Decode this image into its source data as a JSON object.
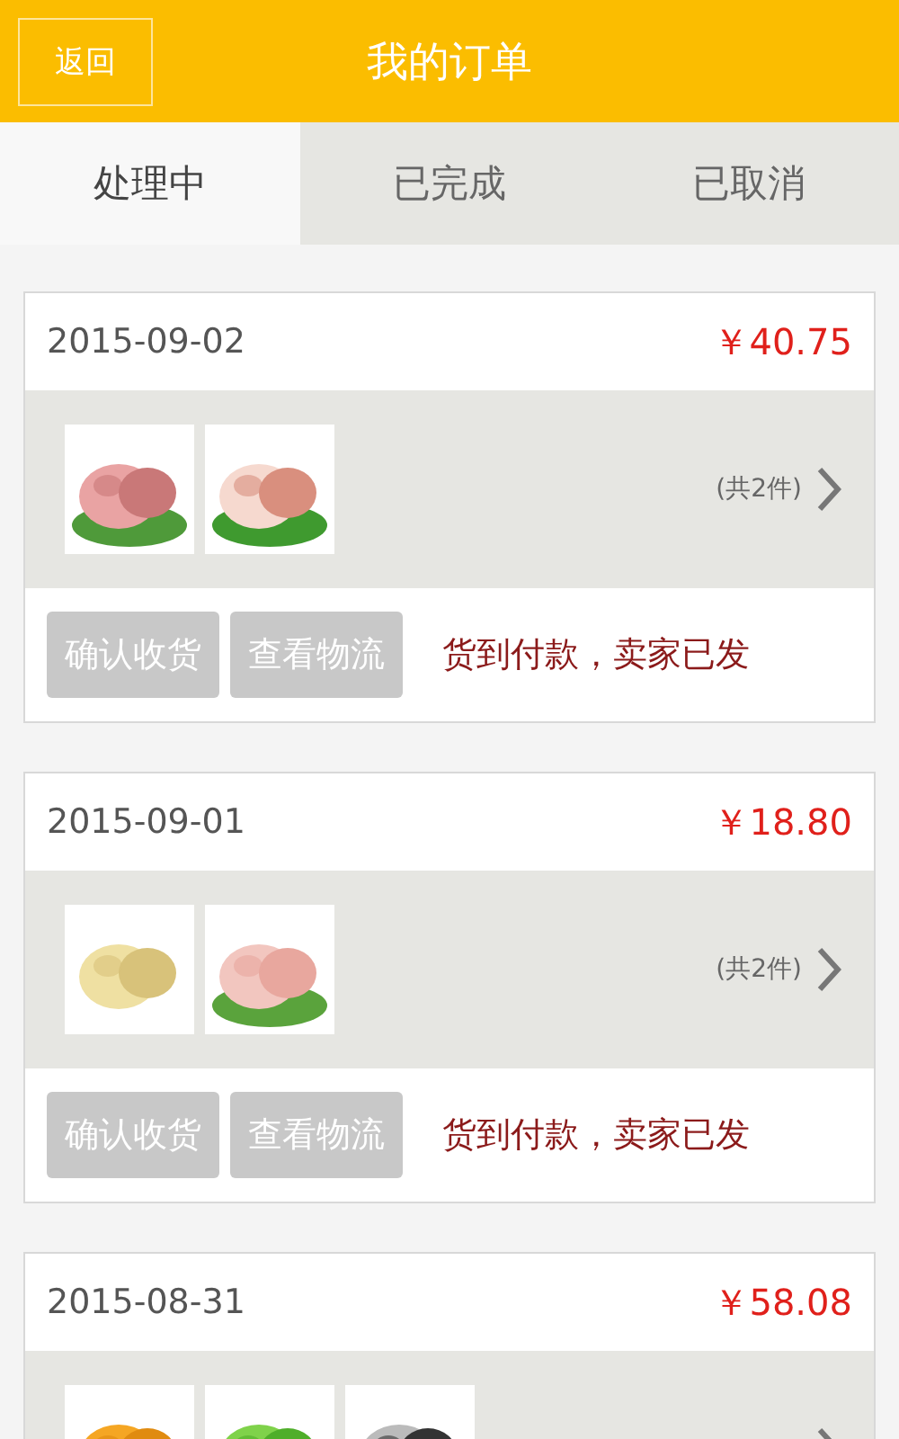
{
  "header": {
    "back": "返回",
    "title": "我的订单"
  },
  "tabs": [
    {
      "label": "处理中",
      "selected": true
    },
    {
      "label": "已完成",
      "selected": false
    },
    {
      "label": "已取消",
      "selected": false
    }
  ],
  "orders": [
    {
      "date": "2015-09-02",
      "price": "￥40.75",
      "items": [
        {
          "kind": "picture"
        },
        {
          "kind": "picture"
        }
      ],
      "count": "(共2件)",
      "actions": [
        "确认收货",
        "查看物流"
      ],
      "status": "货到付款，卖家已发"
    },
    {
      "date": "2015-09-01",
      "price": "￥18.80",
      "items": [
        {
          "kind": "picture"
        },
        {
          "kind": "picture"
        }
      ],
      "count": "(共2件)",
      "actions": [
        "确认收货",
        "查看物流"
      ],
      "status": "货到付款，卖家已发"
    },
    {
      "date": "2015-08-31",
      "price": "￥58.08",
      "items": [
        {
          "kind": "picture"
        },
        {
          "kind": "picture"
        },
        {
          "kind": "picture"
        }
      ]
    }
  ]
}
